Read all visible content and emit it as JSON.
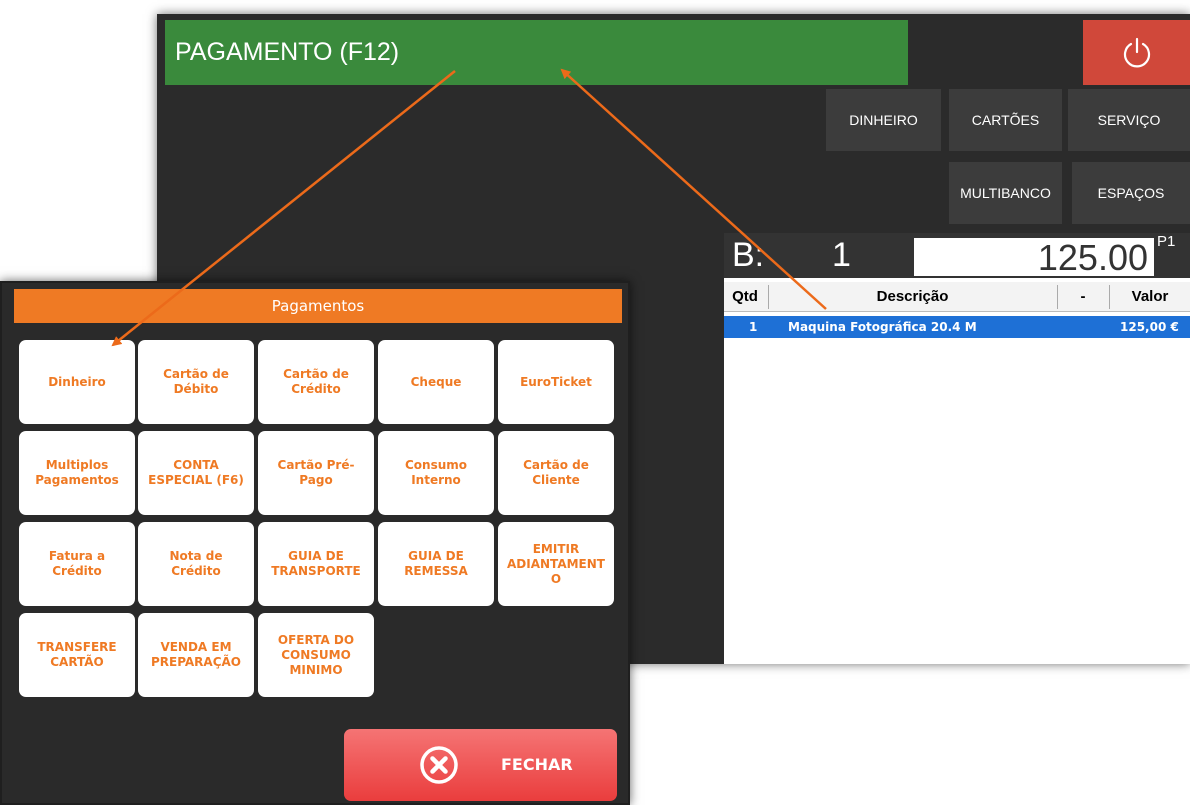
{
  "window": {
    "title": "PAGAMENTO (F12)"
  },
  "toolbar": {
    "power_icon": "power-icon",
    "category_buttons": [
      "DINHEIRO",
      "CARTÕES",
      "SERVIÇO",
      "MULTIBANCO",
      "ESPAÇOS"
    ]
  },
  "bill": {
    "prefix": "B:",
    "number": "1",
    "total": "125.00",
    "page": "P1",
    "columns": [
      "Qtd",
      "Descrição",
      "-",
      "Valor"
    ],
    "rows": [
      {
        "qty": "1",
        "description": "Maquina Fotográfica 20.4 M",
        "value": "125,00 €"
      }
    ]
  },
  "payments_dialog": {
    "title": "Pagamentos",
    "buttons": [
      "Dinheiro",
      "Cartão de\nDébito",
      "Cartão de\nCrédito",
      "Cheque",
      "EuroTicket",
      "Multiplos\nPagamentos",
      "CONTA\nESPECIAL (F6)",
      "Cartão Pré-\nPago",
      "Consumo\nInterno",
      "Cartão de\nCliente",
      "Fatura a\nCrédito",
      "Nota de\nCrédito",
      "GUIA DE\nTRANSPORTE",
      "GUIA DE\nREMESSA",
      "EMITIR\nADIANTAMENT\nO",
      "TRANSFERE\nCARTÃO",
      "VENDA EM\nPREPARAÇÃO",
      "OFERTA DO\nCONSUMO\nMINIMO"
    ],
    "close_label": "FECHAR"
  },
  "colors": {
    "title_green": "#3a8a3c",
    "power_red": "#d0483a",
    "accent_orange": "#ef7a24",
    "row_selected_blue": "#1e70d6",
    "close_red": "#ea3d3d"
  }
}
